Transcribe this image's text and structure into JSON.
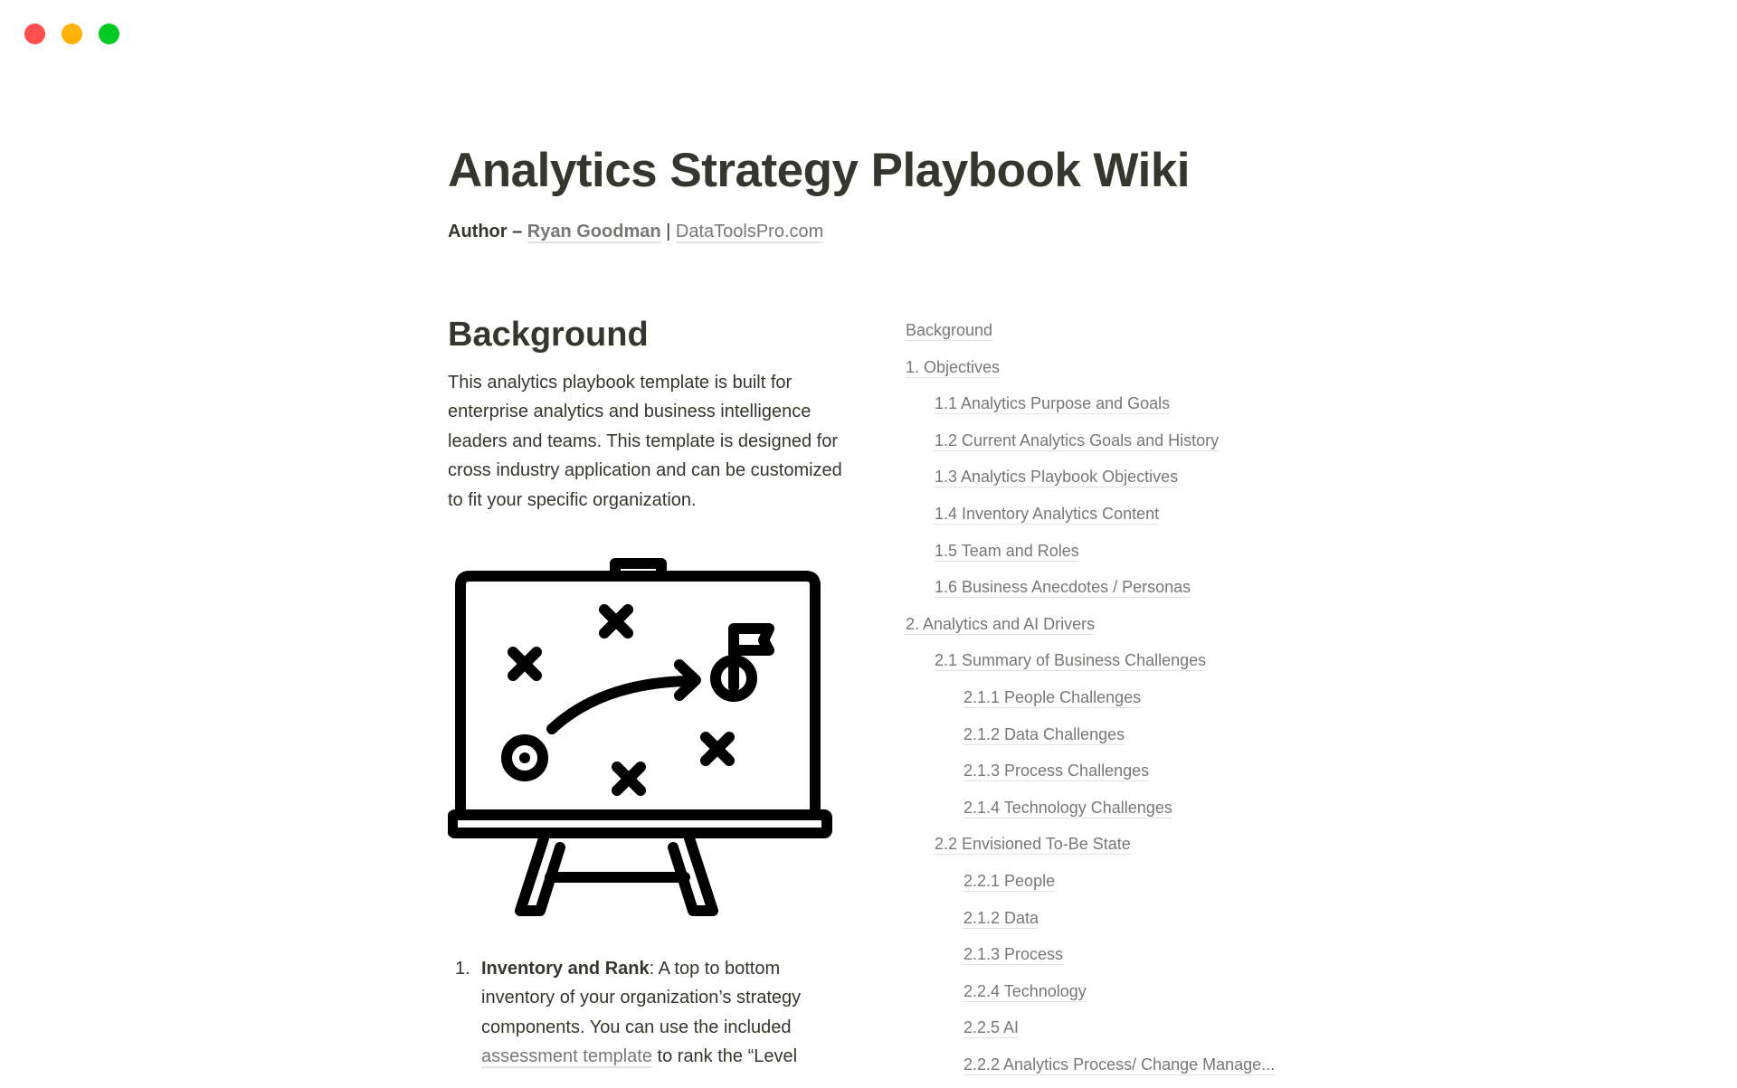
{
  "window": {
    "controls": [
      {
        "name": "close",
        "color": "#FF4F4F"
      },
      {
        "name": "minimize",
        "color": "#FEB208"
      },
      {
        "name": "maximize",
        "color": "#03C923"
      }
    ]
  },
  "header": {
    "title": "Analytics Strategy Playbook Wiki",
    "author_label": "Author –",
    "author_name": "Ryan Goodman",
    "separator": "|",
    "site": "DataToolsPro.com"
  },
  "background": {
    "heading": "Background",
    "paragraph": "This analytics playbook template is built for enterprise analytics and business intelligence leaders and teams. This template is designed for cross industry application and can be customized to fit your specific organization.",
    "illustration": "strategy-playbook-easel-icon"
  },
  "list": [
    {
      "number": "1.",
      "bold": "Inventory and Rank",
      "text_before_link": ": A top to bottom inventory of  your organization’s strategy components. You can use the included ",
      "link": "assessment template",
      "text_after_link": " to rank the “Level"
    }
  ],
  "toc": [
    {
      "label": "Background",
      "level": 0
    },
    {
      "label": "1. Objectives",
      "level": 0
    },
    {
      "label": "1.1 Analytics Purpose and Goals",
      "level": 1
    },
    {
      "label": "1.2 Current Analytics Goals and History",
      "level": 1
    },
    {
      "label": "1.3 Analytics Playbook Objectives",
      "level": 1
    },
    {
      "label": "1.4 Inventory Analytics Content",
      "level": 1
    },
    {
      "label": "1.5 Team and Roles",
      "level": 1
    },
    {
      "label": "1.6 Business Anecdotes / Personas",
      "level": 1
    },
    {
      "label": "2. Analytics and AI Drivers",
      "level": 0
    },
    {
      "label": "2.1 Summary of Business Challenges",
      "level": 1
    },
    {
      "label": "2.1.1 People Challenges",
      "level": 2
    },
    {
      "label": "2.1.2 Data Challenges",
      "level": 2
    },
    {
      "label": "2.1.3 Process Challenges",
      "level": 2
    },
    {
      "label": "2.1.4 Technology Challenges",
      "level": 2
    },
    {
      "label": "2.2 Envisioned To-Be State",
      "level": 1
    },
    {
      "label": "2.2.1 People",
      "level": 2
    },
    {
      "label": "2.1.2 Data",
      "level": 2
    },
    {
      "label": "2.1.3 Process",
      "level": 2
    },
    {
      "label": "2.2.4 Technology",
      "level": 2
    },
    {
      "label": "2.2.5 AI",
      "level": 2
    },
    {
      "label": "2.2.2 Analytics Process/ Change Manage...",
      "level": 2
    }
  ],
  "colors": {
    "text": "#37352F",
    "link_text": "#787774",
    "link_underline": "#E3E2E0"
  }
}
